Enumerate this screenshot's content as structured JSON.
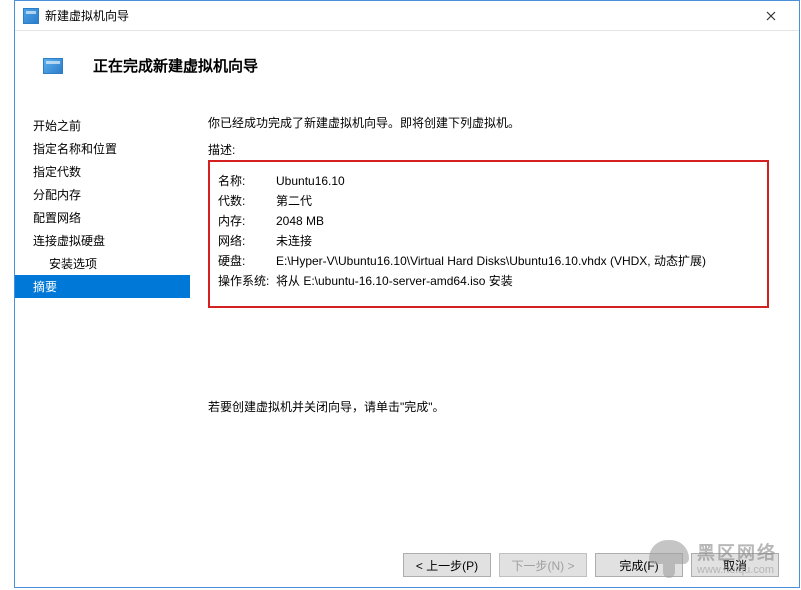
{
  "window": {
    "title": "新建虚拟机向导"
  },
  "header": {
    "title": "正在完成新建虚拟机向导"
  },
  "sidebar": {
    "steps": [
      {
        "label": "开始之前",
        "indent": false,
        "selected": false
      },
      {
        "label": "指定名称和位置",
        "indent": false,
        "selected": false
      },
      {
        "label": "指定代数",
        "indent": false,
        "selected": false
      },
      {
        "label": "分配内存",
        "indent": false,
        "selected": false
      },
      {
        "label": "配置网络",
        "indent": false,
        "selected": false
      },
      {
        "label": "连接虚拟硬盘",
        "indent": false,
        "selected": false
      },
      {
        "label": "安装选项",
        "indent": true,
        "selected": false
      },
      {
        "label": "摘要",
        "indent": false,
        "selected": true
      }
    ]
  },
  "content": {
    "intro": "你已经成功完成了新建虚拟机向导。即将创建下列虚拟机。",
    "desc_label": "描述:",
    "summary": [
      {
        "key": "名称:",
        "value": "Ubuntu16.10"
      },
      {
        "key": "代数:",
        "value": "第二代"
      },
      {
        "key": "内存:",
        "value": "2048 MB"
      },
      {
        "key": "网络:",
        "value": "未连接"
      },
      {
        "key": "硬盘:",
        "value": "E:\\Hyper-V\\Ubuntu16.10\\Virtual Hard Disks\\Ubuntu16.10.vhdx (VHDX, 动态扩展)"
      },
      {
        "key": "操作系统:",
        "value": "将从 E:\\ubuntu-16.10-server-amd64.iso 安装"
      }
    ],
    "instruction": "若要创建虚拟机并关闭向导，请单击\"完成\"。"
  },
  "footer": {
    "back": "< 上一步(P)",
    "next": "下一步(N) >",
    "finish": "完成(F)",
    "cancel": "取消"
  },
  "watermark": {
    "big": "黑区网络",
    "small": "www.heiqu.com"
  }
}
